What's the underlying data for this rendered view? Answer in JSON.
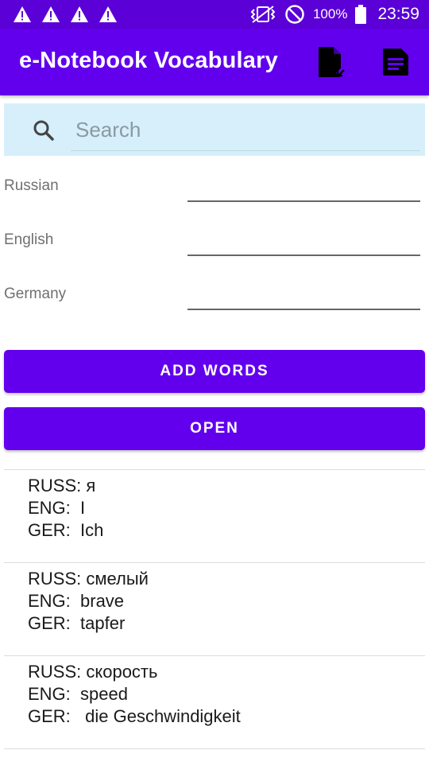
{
  "status_bar": {
    "battery_text": "100%",
    "clock": "23:59",
    "icons": [
      "warning-icon",
      "warning-icon",
      "warning-icon",
      "warning-icon",
      "vibrate-icon",
      "do-not-disturb-icon",
      "battery-icon"
    ]
  },
  "app_bar": {
    "title": "e-Notebook Vocabulary",
    "actions": [
      "file-import-icon",
      "document-icon"
    ]
  },
  "search": {
    "placeholder": "Search"
  },
  "fields": {
    "russian_label": "Russian",
    "english_label": "English",
    "german_label": "Germany"
  },
  "buttons": {
    "add_words": "ADD WORDS",
    "open": "OPEN"
  },
  "words": [
    {
      "russ": "RUSS: я",
      "eng": "ENG:  I",
      "ger": "GER:  Ich"
    },
    {
      "russ": "RUSS: смелый",
      "eng": "ENG:  brave",
      "ger": "GER:  tapfer"
    },
    {
      "russ": "RUSS: скорость",
      "eng": "ENG:  speed",
      "ger": "GER:   die Geschwindigkeit"
    }
  ],
  "colors": {
    "status_bar": "#5b00d6",
    "primary": "#6200ee",
    "search_background": "#d6effa"
  }
}
